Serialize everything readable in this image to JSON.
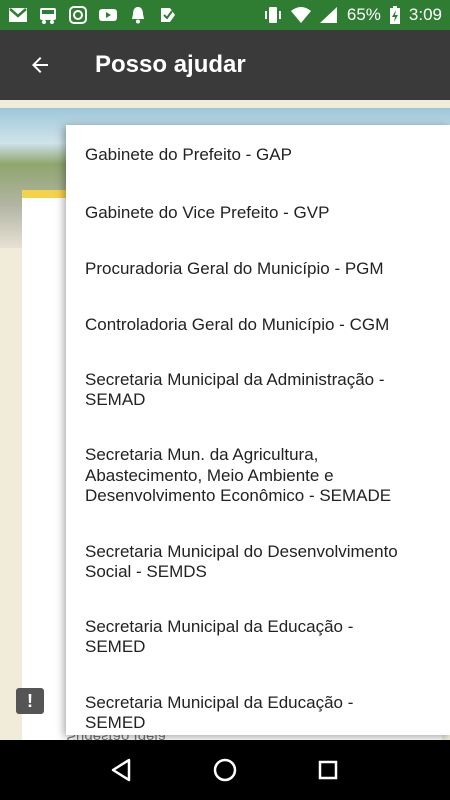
{
  "status_bar": {
    "battery_percent": "65%",
    "time": "3:09",
    "icons": [
      "gmail-icon",
      "bus-icon",
      "instagram-icon",
      "youtube-icon",
      "bell-icon",
      "check-icon",
      "vibrate-icon",
      "wifi-icon",
      "signal-icon",
      "battery-charging-icon"
    ]
  },
  "toolbar": {
    "title": "Posso ajudar",
    "back_icon": "arrow-left-icon"
  },
  "background": {
    "card_text": "Sugestão Ideia"
  },
  "menu": {
    "items": [
      {
        "label": "Gabinete do Prefeito - GAP"
      },
      {
        "label": "Gabinete do Vice Prefeito - GVP"
      },
      {
        "label": "Procuradoria Geral do Município - PGM"
      },
      {
        "label": "Controladoria Geral do Município - CGM"
      },
      {
        "label": "Secretaria Municipal da Administração - SEMAD"
      },
      {
        "label": "Secretaria Mun. da Agricultura, Abastecimento, Meio Ambiente e Desenvolvimento Econômico - SEMADE"
      },
      {
        "label": "Secretaria Municipal do Desenvolvimento Social - SEMDS"
      },
      {
        "label": "Secretaria Municipal da Educação - SEMED"
      },
      {
        "label": "Secretaria Municipal da Educação - SEMED"
      }
    ]
  },
  "nav_bar": {
    "back": "back-triangle-icon",
    "home": "home-circle-icon",
    "recents": "recents-square-icon"
  },
  "colors": {
    "status_bar": "#2e7d32",
    "toolbar": "#3a3a3a",
    "accent_yellow": "#f5d24b"
  }
}
